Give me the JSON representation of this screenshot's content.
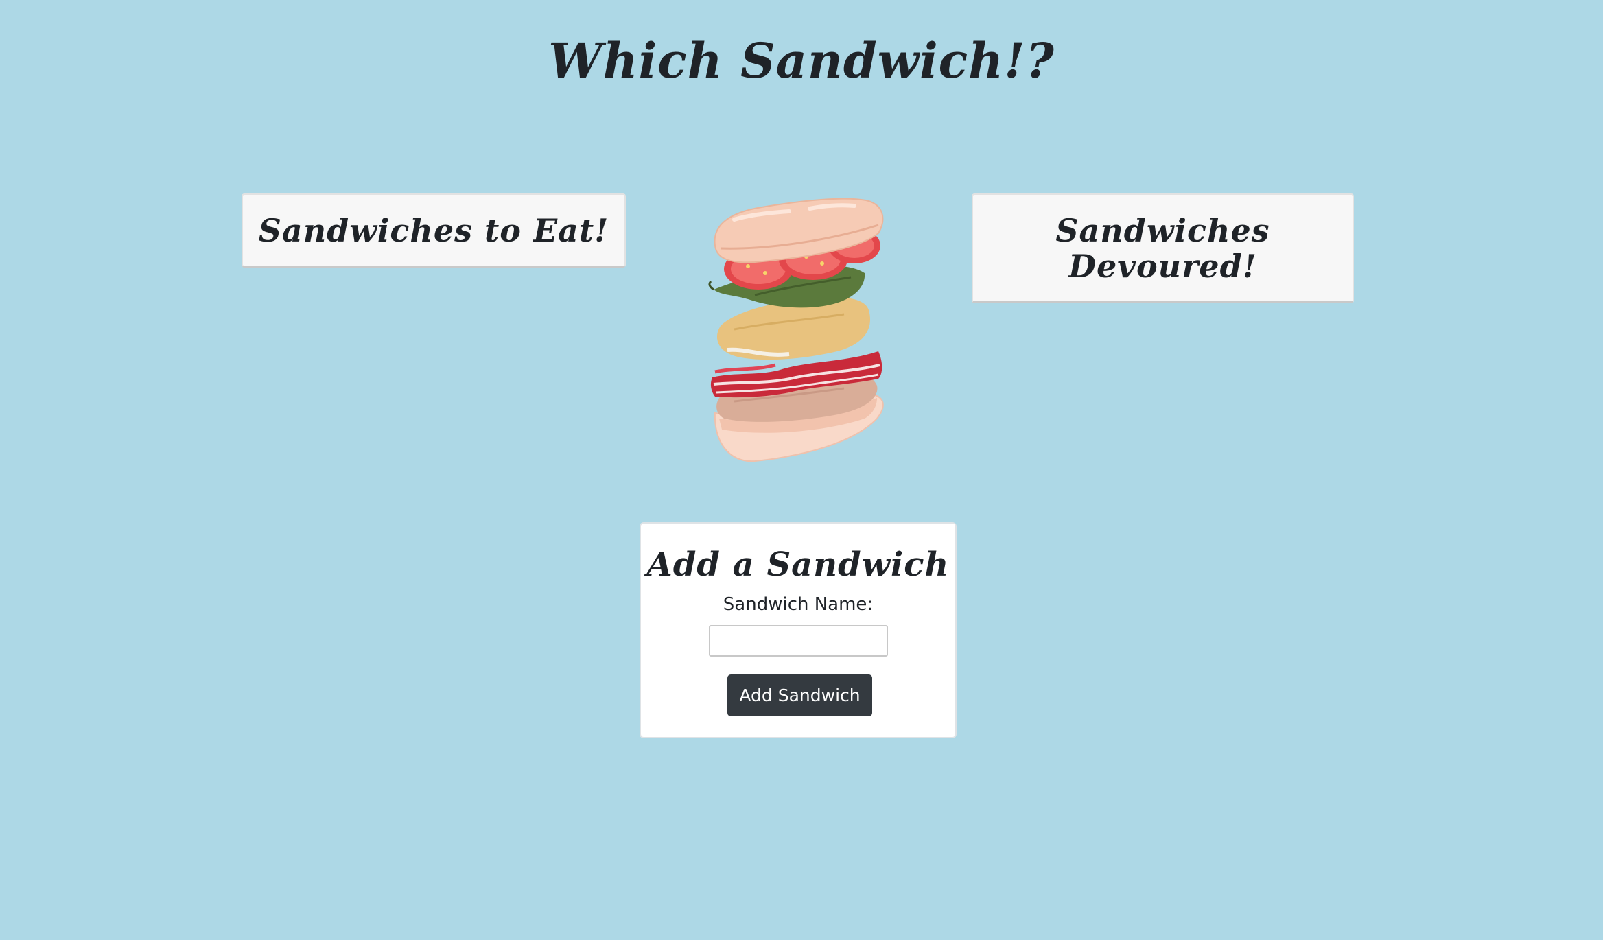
{
  "page": {
    "title": "Which Sandwich!?"
  },
  "lists": {
    "to_eat": {
      "heading": "Sandwiches to Eat!",
      "items": []
    },
    "devoured": {
      "heading": "Sandwiches Devoured!",
      "items": []
    }
  },
  "illustration": {
    "icon": "sandwich-illustration"
  },
  "form": {
    "heading": "Add a Sandwich",
    "name_label": "Sandwich Name:",
    "name_value": "",
    "name_placeholder": "",
    "submit_label": "Add Sandwich"
  },
  "colors": {
    "background": "#add8e6",
    "text": "#1f2328",
    "panel": "#f7f7f7",
    "button": "#343a40",
    "button_text": "#ffffff"
  }
}
